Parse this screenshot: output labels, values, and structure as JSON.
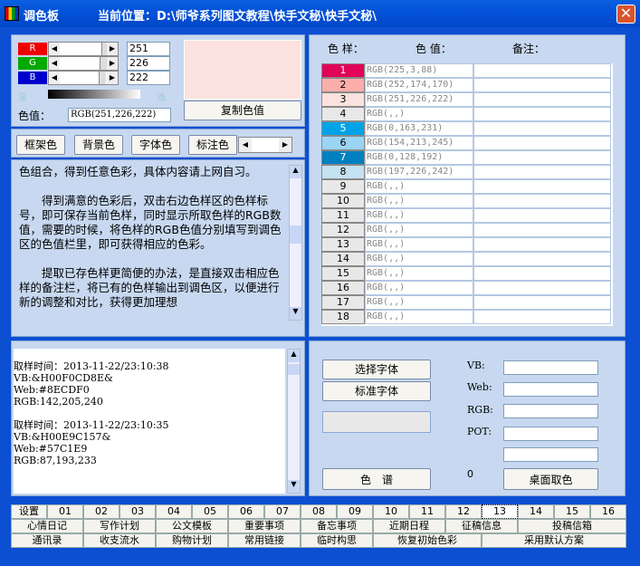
{
  "window": {
    "title": "调色板",
    "location": "当前位置：D:\\师爷系列图文教程\\快手文秘\\快手文秘\\",
    "close": "✕"
  },
  "rgb": {
    "r_label": "R",
    "g_label": "G",
    "b_label": "B",
    "r": "251",
    "g": "226",
    "b": "222",
    "light_dark_left": "深",
    "light_dark_right": "浅",
    "color_value_label": "色值：",
    "color_value": "RGB(251,226,222)",
    "preview_color": "#FBE2DE",
    "copy_btn": "复制色值"
  },
  "target_buttons": [
    "框架色",
    "背景色",
    "字体色",
    "标注色"
  ],
  "help_text": "色组合，得到任意色彩，具体内容请上网自习。\n\n　　得到满意的色彩后，双击右边色样区的色样标号，即可保存当前色样，同时显示所取色样的RGB数值，需要的时候，将色样的RGB色值分别填写到调色区的色值栏里，即可获得相应的色彩。\n\n　　提取已存色样更简便的办法，是直接双击相应色样的备注栏，将已有的色样输出到调色区，以便进行新的调整和对比，获得更加理想",
  "swatch_header": {
    "sample": "色 样：",
    "value": "色 值：",
    "note": "备注："
  },
  "swatches": [
    {
      "num": "1",
      "color": "#E10358",
      "value": "RGB(225,3,88)"
    },
    {
      "num": "2",
      "color": "#FCAEAA",
      "value": "RGB(252,174,170)"
    },
    {
      "num": "3",
      "color": "#FBE2DE",
      "value": "RGB(251,226,222)"
    },
    {
      "num": "4",
      "color": "#E8E8E8",
      "value": "RGB(,,)"
    },
    {
      "num": "5",
      "color": "#00A3E7",
      "value": "RGB(0,163,231)"
    },
    {
      "num": "6",
      "color": "#9AD5F5",
      "value": "RGB(154,213,245)"
    },
    {
      "num": "7",
      "color": "#0080C0",
      "value": "RGB(0,128,192)"
    },
    {
      "num": "8",
      "color": "#C5E2F2",
      "value": "RGB(197,226,242)"
    },
    {
      "num": "9",
      "color": "#E8E8E8",
      "value": "RGB(,,)"
    },
    {
      "num": "10",
      "color": "#E8E8E8",
      "value": "RGB(,,)"
    },
    {
      "num": "11",
      "color": "#E8E8E8",
      "value": "RGB(,,)"
    },
    {
      "num": "12",
      "color": "#E8E8E8",
      "value": "RGB(,,)"
    },
    {
      "num": "13",
      "color": "#E8E8E8",
      "value": "RGB(,,)"
    },
    {
      "num": "14",
      "color": "#E8E8E8",
      "value": "RGB(,,)"
    },
    {
      "num": "15",
      "color": "#E8E8E8",
      "value": "RGB(,,)"
    },
    {
      "num": "16",
      "color": "#E8E8E8",
      "value": "RGB(,,)"
    },
    {
      "num": "17",
      "color": "#E8E8E8",
      "value": "RGB(,,)"
    },
    {
      "num": "18",
      "color": "#E8E8E8",
      "value": "RGB(,,)"
    }
  ],
  "log_text": "\n取样时间：2013-11-22/23:10:38\nVB:&H00F0CD8E&\nWeb:#8ECDF0\nRGB:142,205,240\n\n取样时间：2013-11-22/23:10:35\nVB:&H00E9C157&\nWeb:#57C1E9\nRGB:87,193,233",
  "font_panel": {
    "select_font": "选择字体",
    "standard_font": "标准字体",
    "palette": "色　谱",
    "desktop_pick": "桌面取色",
    "counter": "0",
    "vb": "VB:",
    "web": "Web:",
    "rgb": "RGB:",
    "pot": "POT:"
  },
  "num_tabs": [
    "设置",
    "01",
    "02",
    "03",
    "04",
    "05",
    "06",
    "07",
    "08",
    "09",
    "10",
    "11",
    "12",
    "13",
    "14",
    "15",
    "16"
  ],
  "func_row1": [
    "心情日记",
    "写作计划",
    "公文模板",
    "重要事项",
    "备忘事项",
    "近期日程",
    "征稿信息",
    "投稿信箱"
  ],
  "func_row2": [
    "通讯录",
    "收支流水",
    "购物计划",
    "常用链接",
    "临时构思",
    "恢复初始色彩",
    "采用默认方案"
  ]
}
